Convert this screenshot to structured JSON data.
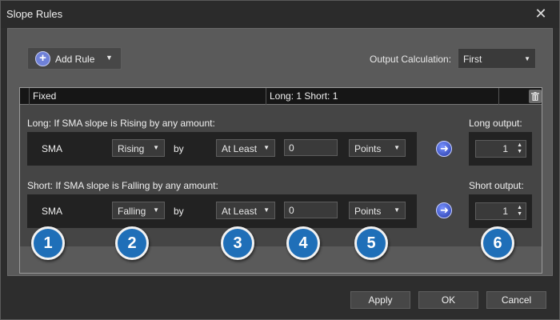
{
  "window": {
    "title": "Slope Rules"
  },
  "toolbar": {
    "add_rule_label": "Add Rule",
    "output_calc_label": "Output Calculation:",
    "output_calc_value": "First"
  },
  "rule_table": {
    "columns": [
      "Fixed",
      "Long: 1 Short: 1"
    ]
  },
  "long": {
    "condition": "Long: If SMA slope is Rising by any amount:",
    "indicator": "SMA",
    "direction": "Rising",
    "by_label": "by",
    "comparator": "At Least",
    "amount": "0",
    "unit": "Points",
    "output_label": "Long output:",
    "output_value": "1"
  },
  "short": {
    "condition": "Short: If SMA slope is Falling by any amount:",
    "indicator": "SMA",
    "direction": "Falling",
    "by_label": "by",
    "comparator": "At Least",
    "amount": "0",
    "unit": "Points",
    "output_label": "Short output:",
    "output_value": "1"
  },
  "callouts": [
    "1",
    "2",
    "3",
    "4",
    "5",
    "6"
  ],
  "footer": {
    "apply": "Apply",
    "ok": "OK",
    "cancel": "Cancel"
  },
  "icons": {
    "add": "plus-circle-icon",
    "close": "close-icon",
    "delete": "trash-icon",
    "go": "arrow-right-circle-icon"
  },
  "colors": {
    "accent_blue": "#1f6fb8",
    "go_blue": "#2338a8"
  }
}
